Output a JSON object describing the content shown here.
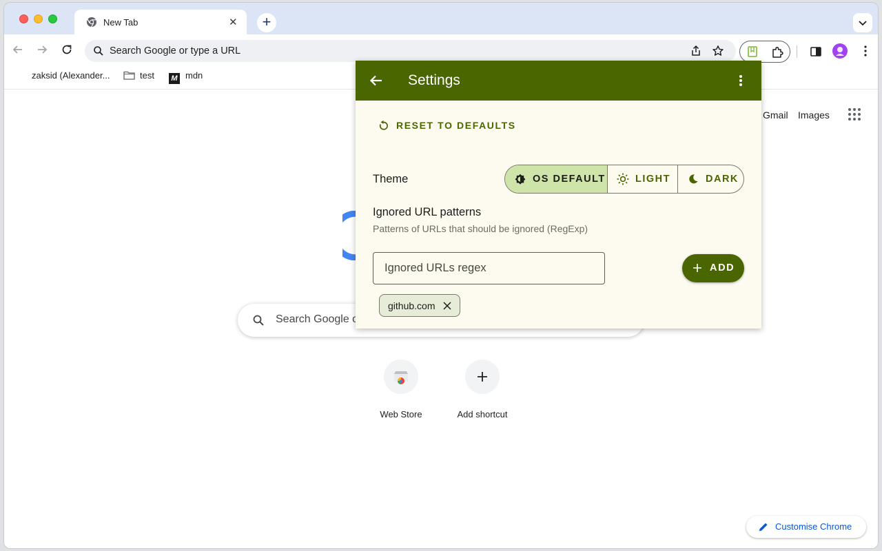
{
  "browser": {
    "tab": {
      "title": "New Tab",
      "icon": "chrome-icon"
    },
    "omnibox": {
      "placeholder": "Search Google or type a URL"
    },
    "bookmarks": [
      {
        "label": "zaksid (Alexander...",
        "icon": "none"
      },
      {
        "label": "test",
        "icon": "folder-icon"
      },
      {
        "label": "mdn",
        "icon": "mdn-icon"
      }
    ]
  },
  "new_tab_page": {
    "links": {
      "gmail": "Gmail",
      "images": "Images"
    },
    "search_placeholder": "Search Google or type a URL",
    "shortcuts": [
      {
        "label": "Web Store",
        "icon": "webstore-icon"
      },
      {
        "label": "Add shortcut",
        "icon": "plus-icon"
      }
    ],
    "customise_label": "Customise Chrome"
  },
  "popup": {
    "title": "Settings",
    "reset_label": "RESET TO DEFAULTS",
    "theme": {
      "label": "Theme",
      "options": [
        {
          "label": "OS DEFAULT",
          "icon": "contrast-icon",
          "selected": true
        },
        {
          "label": "LIGHT",
          "icon": "sun-icon",
          "selected": false
        },
        {
          "label": "DARK",
          "icon": "moon-icon",
          "selected": false
        }
      ]
    },
    "ignored": {
      "title": "Ignored URL patterns",
      "subtitle": "Patterns of URLs that should be ignored (RegExp)",
      "input_placeholder": "Ignored URLs regex",
      "add_label": "ADD",
      "chips": [
        "github.com"
      ]
    },
    "colors": {
      "header": "#4a6600",
      "surface": "#fdfaf0",
      "accent": "#4a6600",
      "selected_segment": "#cfe4a8"
    }
  }
}
